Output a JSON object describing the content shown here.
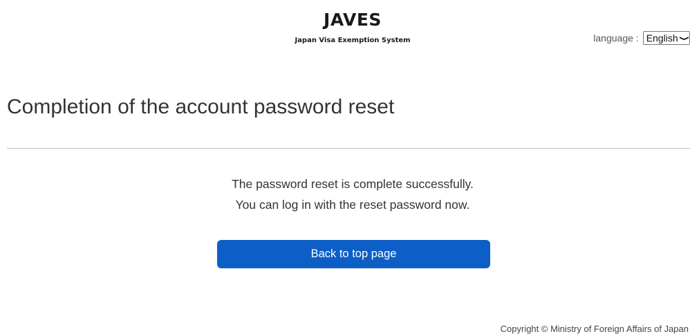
{
  "header": {
    "title": "JAVES",
    "subtitle": "Japan Visa Exemption System",
    "language_label": "language :",
    "language_selected": "English"
  },
  "page": {
    "title": "Completion of the account password reset",
    "message_line1": "The password reset is complete successfully.",
    "message_line2": "You can log in with the reset password now.",
    "back_button_label": "Back to top page"
  },
  "footer": {
    "copyright": "Copyright © Ministry of Foreign Affairs of Japan"
  },
  "colors": {
    "primary_button": "#0d5fc7",
    "text": "#333333",
    "divider": "#bdbdbd"
  },
  "icons": {
    "language_dropdown": "chevron-down-icon"
  }
}
